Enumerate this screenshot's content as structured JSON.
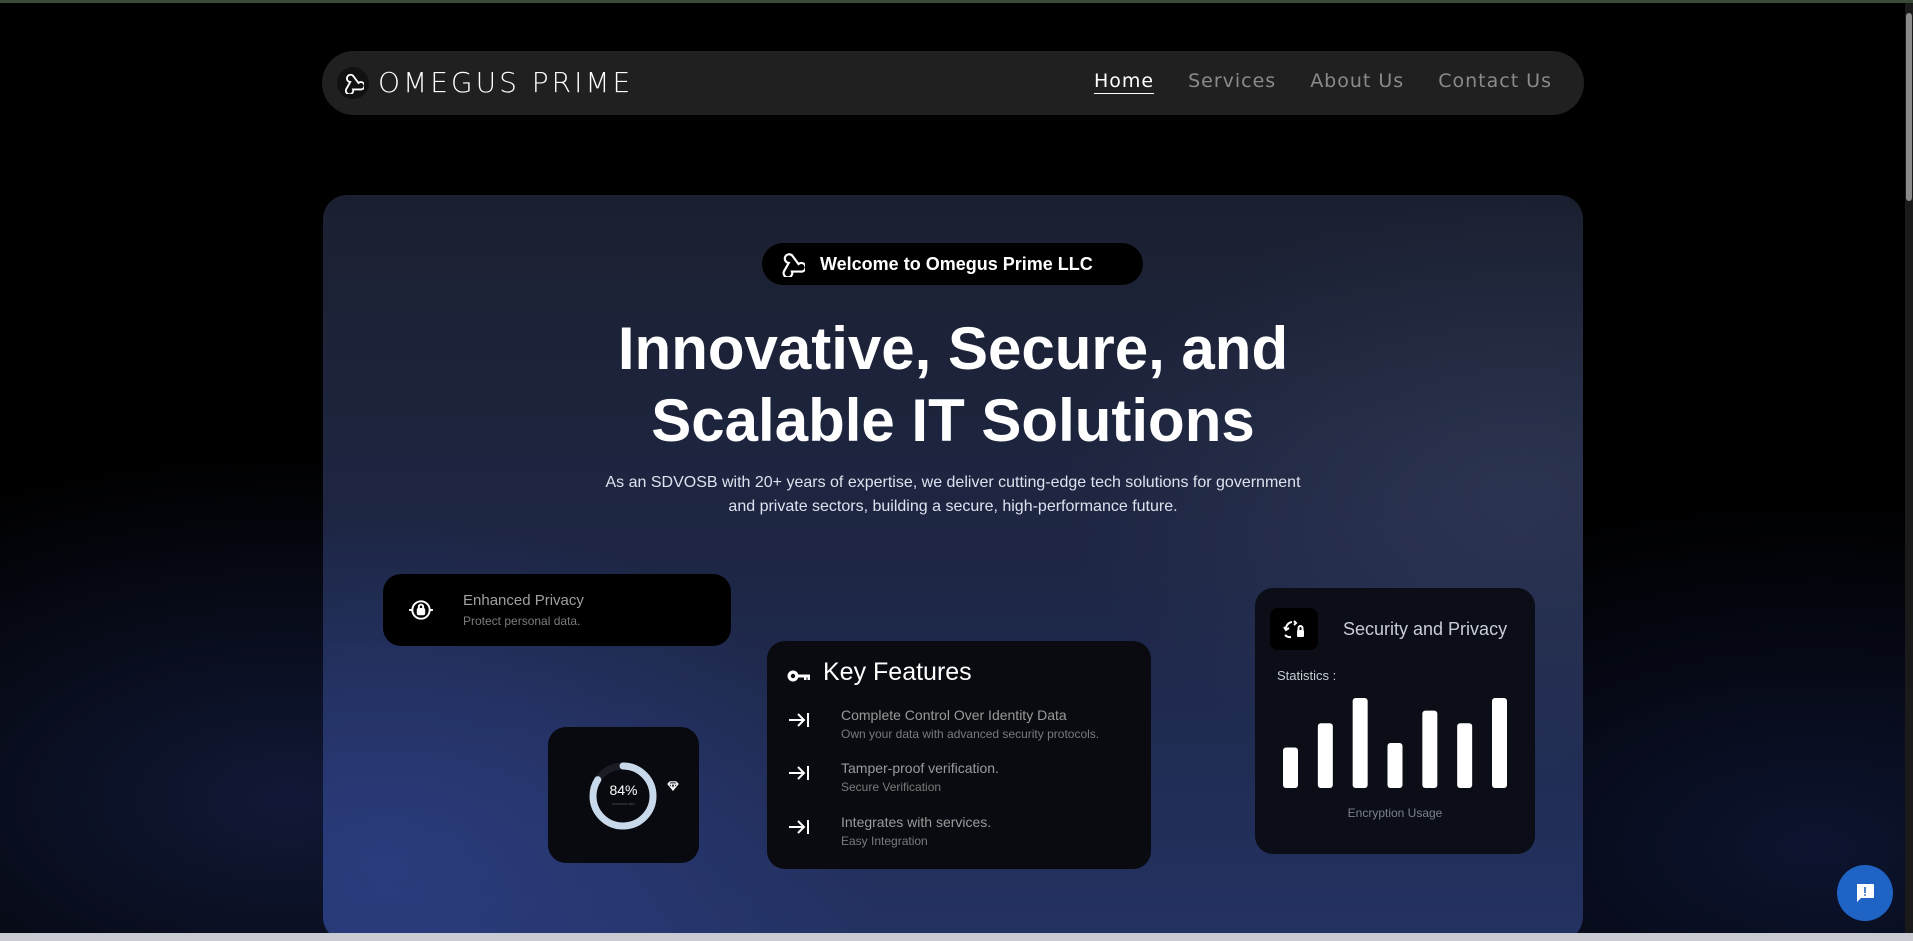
{
  "nav": {
    "brand": "OMEGUS PRIME",
    "links": [
      {
        "label": "Home",
        "active": true
      },
      {
        "label": "Services",
        "active": false
      },
      {
        "label": "About Us",
        "active": false
      },
      {
        "label": "Contact Us",
        "active": false
      }
    ],
    "logo_icon": "triskelion-icon"
  },
  "hero": {
    "welcome_badge": "Welcome to Omegus Prime LLC",
    "headline_line1": "Innovative, Secure, and",
    "headline_line2": "Scalable IT Solutions",
    "subtext": "As an SDVOSB with 20+ years of expertise, we deliver cutting-edge tech solutions for government and private sectors, building a secure, high-performance future."
  },
  "privacy_card": {
    "title": "Enhanced Privacy",
    "subtitle": "Protect personal data.",
    "icon": "lock-icon"
  },
  "gauge_card": {
    "value_label": "84%",
    "small_label": "success rate",
    "fraction": 0.84,
    "icon": "diamond-icon"
  },
  "features_card": {
    "title": "Key Features",
    "icon": "key-icon",
    "items": [
      {
        "title": "Complete Control Over Identity Data",
        "subtitle": "Own your data with advanced security protocols."
      },
      {
        "title": "Tamper-proof verification.",
        "subtitle": "Secure Verification"
      },
      {
        "title": "Integrates with services.",
        "subtitle": "Easy Integration"
      }
    ]
  },
  "stats_card": {
    "title": "Security and Privacy",
    "label": "Statistics :",
    "caption": "Encryption Usage",
    "icon": "sync-lock-icon",
    "bars": [
      0.45,
      0.72,
      1.0,
      0.5,
      0.86,
      0.72,
      1.0
    ]
  },
  "colors": {
    "accent": "#1f63c4",
    "nav_bg": "#202020"
  }
}
